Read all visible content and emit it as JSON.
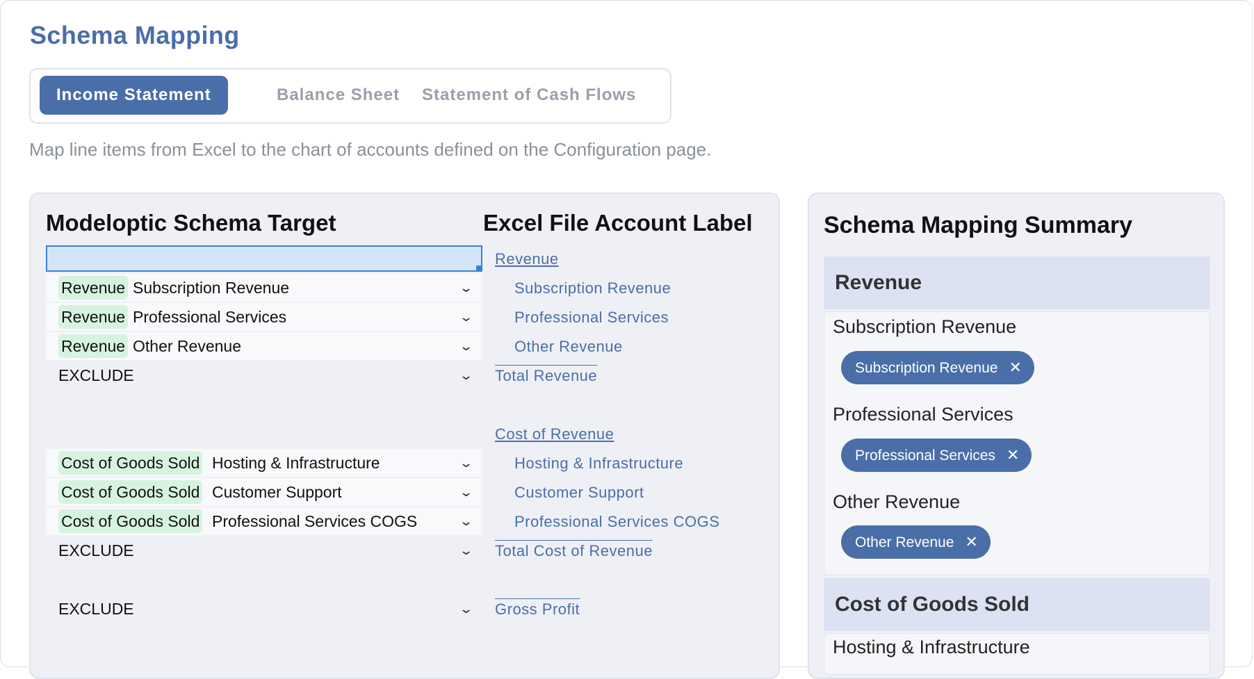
{
  "page": {
    "title": "Schema Mapping",
    "subtitle": "Map line items from Excel to the chart of accounts defined on the Configuration page."
  },
  "tabs": [
    "Income Statement",
    "Balance Sheet",
    "Statement of Cash Flows"
  ],
  "left": {
    "target_header": "Modeloptic Schema Target",
    "excel_header": "Excel File Account Label",
    "rows": [
      {
        "tag": "Revenue",
        "value": "Subscription Revenue"
      },
      {
        "tag": "Revenue",
        "value": "Professional Services"
      },
      {
        "tag": "Revenue",
        "value": "Other Revenue"
      },
      {
        "exclude": "EXCLUDE"
      },
      {
        "tag": "Cost of Goods Sold",
        "value": "Hosting & Infrastructure"
      },
      {
        "tag": "Cost of Goods Sold",
        "value": "Customer Support"
      },
      {
        "tag": "Cost of Goods Sold",
        "value": "Professional Services COGS"
      },
      {
        "exclude": "EXCLUDE"
      },
      {
        "exclude": "EXCLUDE"
      }
    ],
    "excel_labels": [
      "Revenue",
      "Subscription Revenue",
      "Professional Services",
      "Other Revenue",
      "Total Revenue",
      "Cost of Revenue",
      "Hosting & Infrastructure",
      "Customer Support",
      "Professional Services COGS",
      "Total Cost of Revenue",
      "Gross Profit"
    ]
  },
  "summary": {
    "title": "Schema Mapping Summary",
    "categories": [
      {
        "name": "Revenue",
        "items": [
          {
            "label": "Subscription Revenue",
            "chip": "Subscription Revenue"
          },
          {
            "label": "Professional Services",
            "chip": "Professional Services"
          },
          {
            "label": "Other Revenue",
            "chip": "Other Revenue"
          }
        ]
      },
      {
        "name": "Cost of Goods Sold",
        "items": [
          {
            "label": "Hosting & Infrastructure"
          }
        ]
      }
    ]
  },
  "icons": {
    "chevron": "chevron-down-icon",
    "remove": "close-icon"
  },
  "colors": {
    "accent": "#4a6ea8",
    "tag_green": "#d6f3e0",
    "panel_bg": "#eff0f5",
    "category_bg": "#dde2f2"
  }
}
